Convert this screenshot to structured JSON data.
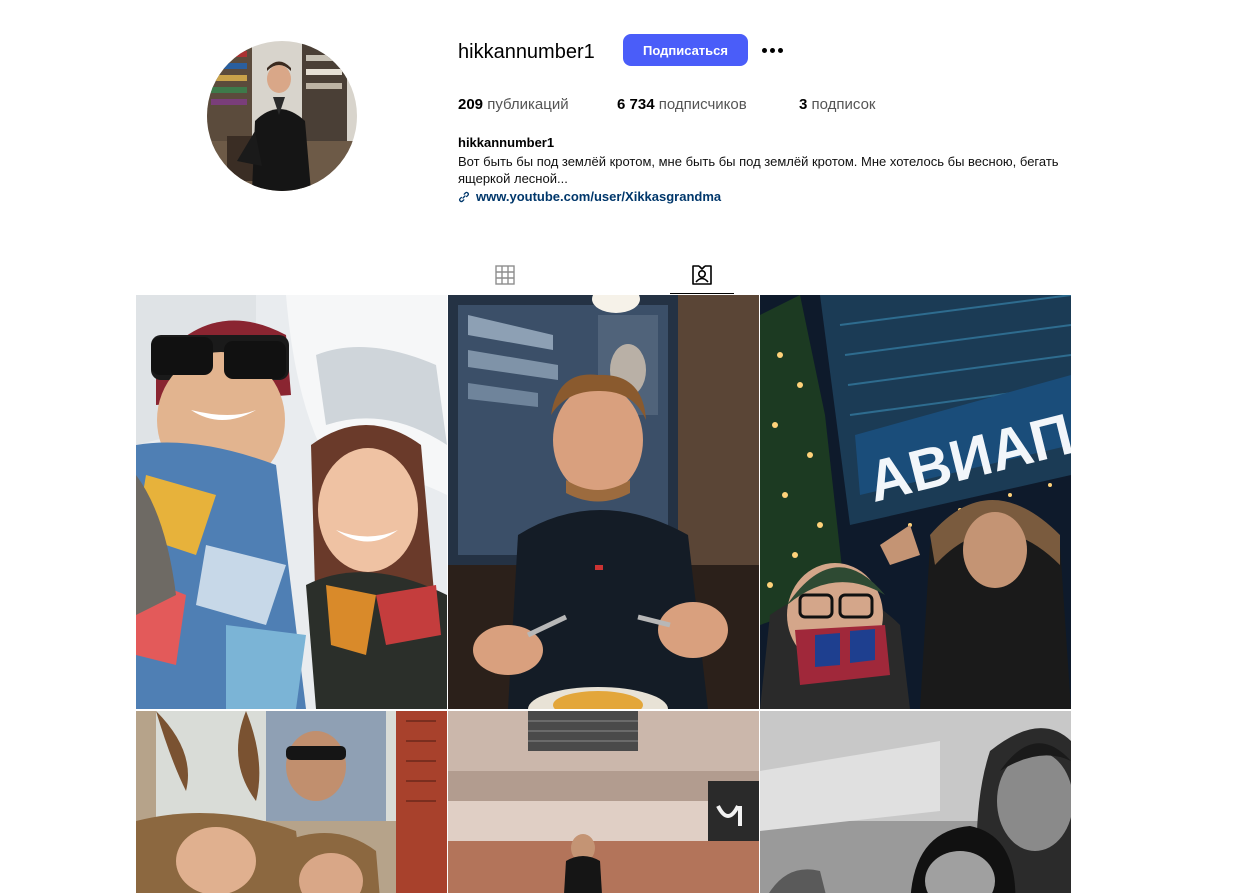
{
  "profile": {
    "username": "hikkannumber1",
    "follow_label": "Подписаться",
    "stats": {
      "posts_count": "209",
      "posts_label": "публикаций",
      "followers_count": "6 734",
      "followers_label": "подписчиков",
      "following_count": "3",
      "following_label": "подписок"
    },
    "bio": {
      "name": "hikkannumber1",
      "text": "Вот быть бы под землёй кротом, мне быть бы под землёй кротом. Мне хотелось бы весною, бегать ящеркой лесной...",
      "link": "www.youtube.com/user/Xikkasgrandma"
    }
  },
  "tabs": [
    {
      "icon": "grid-icon",
      "active": false
    },
    {
      "icon": "tagged-icon",
      "active": true
    }
  ],
  "photo_grid": {
    "tiles": [
      {
        "icon": "photo-snow-selfie"
      },
      {
        "icon": "photo-restaurant"
      },
      {
        "icon": "photo-aviapark-night",
        "sign_text": "АВИАПАР"
      },
      {
        "icon": "photo-street-poster"
      },
      {
        "icon": "photo-building-facade"
      },
      {
        "icon": "photo-black-white"
      }
    ]
  },
  "colors": {
    "accent": "#4a5df9",
    "link": "#00376b",
    "label_gray": "#555555"
  }
}
